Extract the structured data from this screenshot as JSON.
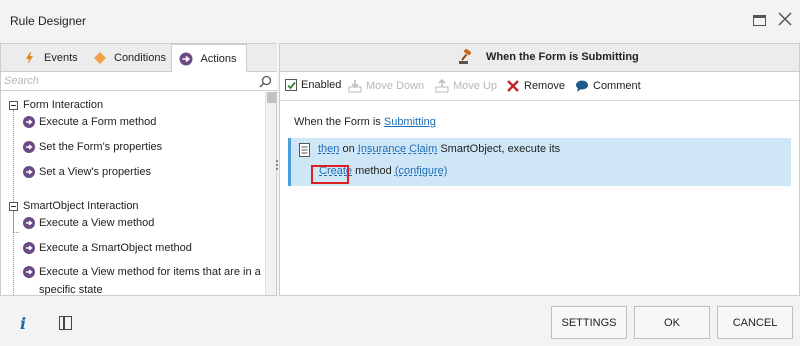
{
  "window": {
    "title": "Rule Designer"
  },
  "left_tabs": [
    {
      "label": "Events",
      "icon": "lightning-icon"
    },
    {
      "label": "Conditions",
      "icon": "diamond-icon"
    },
    {
      "label": "Actions",
      "icon": "arrow-circle-icon",
      "selected": true
    }
  ],
  "search": {
    "placeholder": "Search",
    "value": ""
  },
  "tree": {
    "groups": [
      {
        "label": "Form Interaction",
        "items": [
          "Execute a Form method",
          "Set the Form's properties",
          "Set a View's properties"
        ]
      },
      {
        "label": "SmartObject Interaction",
        "items": [
          "Execute a View method",
          "Execute a SmartObject method",
          "Execute a View method for items that are in a specific state"
        ]
      }
    ]
  },
  "right": {
    "header_title": "When the Form is Submitting",
    "toolbar": {
      "enabled_label": "Enabled",
      "enabled_checked": true,
      "move_down_label": "Move Down",
      "move_up_label": "Move Up",
      "remove_label": "Remove",
      "comment_label": "Comment"
    },
    "rule": {
      "line1_prefix": "When the Form is ",
      "line1_link": "Submitting",
      "action_then": "then",
      "action_on": " on ",
      "action_object": "Insurance Claim",
      "action_suffix": " SmartObject, execute its",
      "action_method": "Create",
      "action_method_text": " method ",
      "action_configure": "(configure)"
    }
  },
  "buttons": {
    "settings": "SETTINGS",
    "ok": "OK",
    "cancel": "CANCEL"
  },
  "colors": {
    "accent": "#1e6fb9",
    "action_highlight": "#cfe6f7",
    "arrow_purple": "#6b4a86",
    "remove_red": "#c0282f",
    "highlight_box": "#e02020"
  }
}
